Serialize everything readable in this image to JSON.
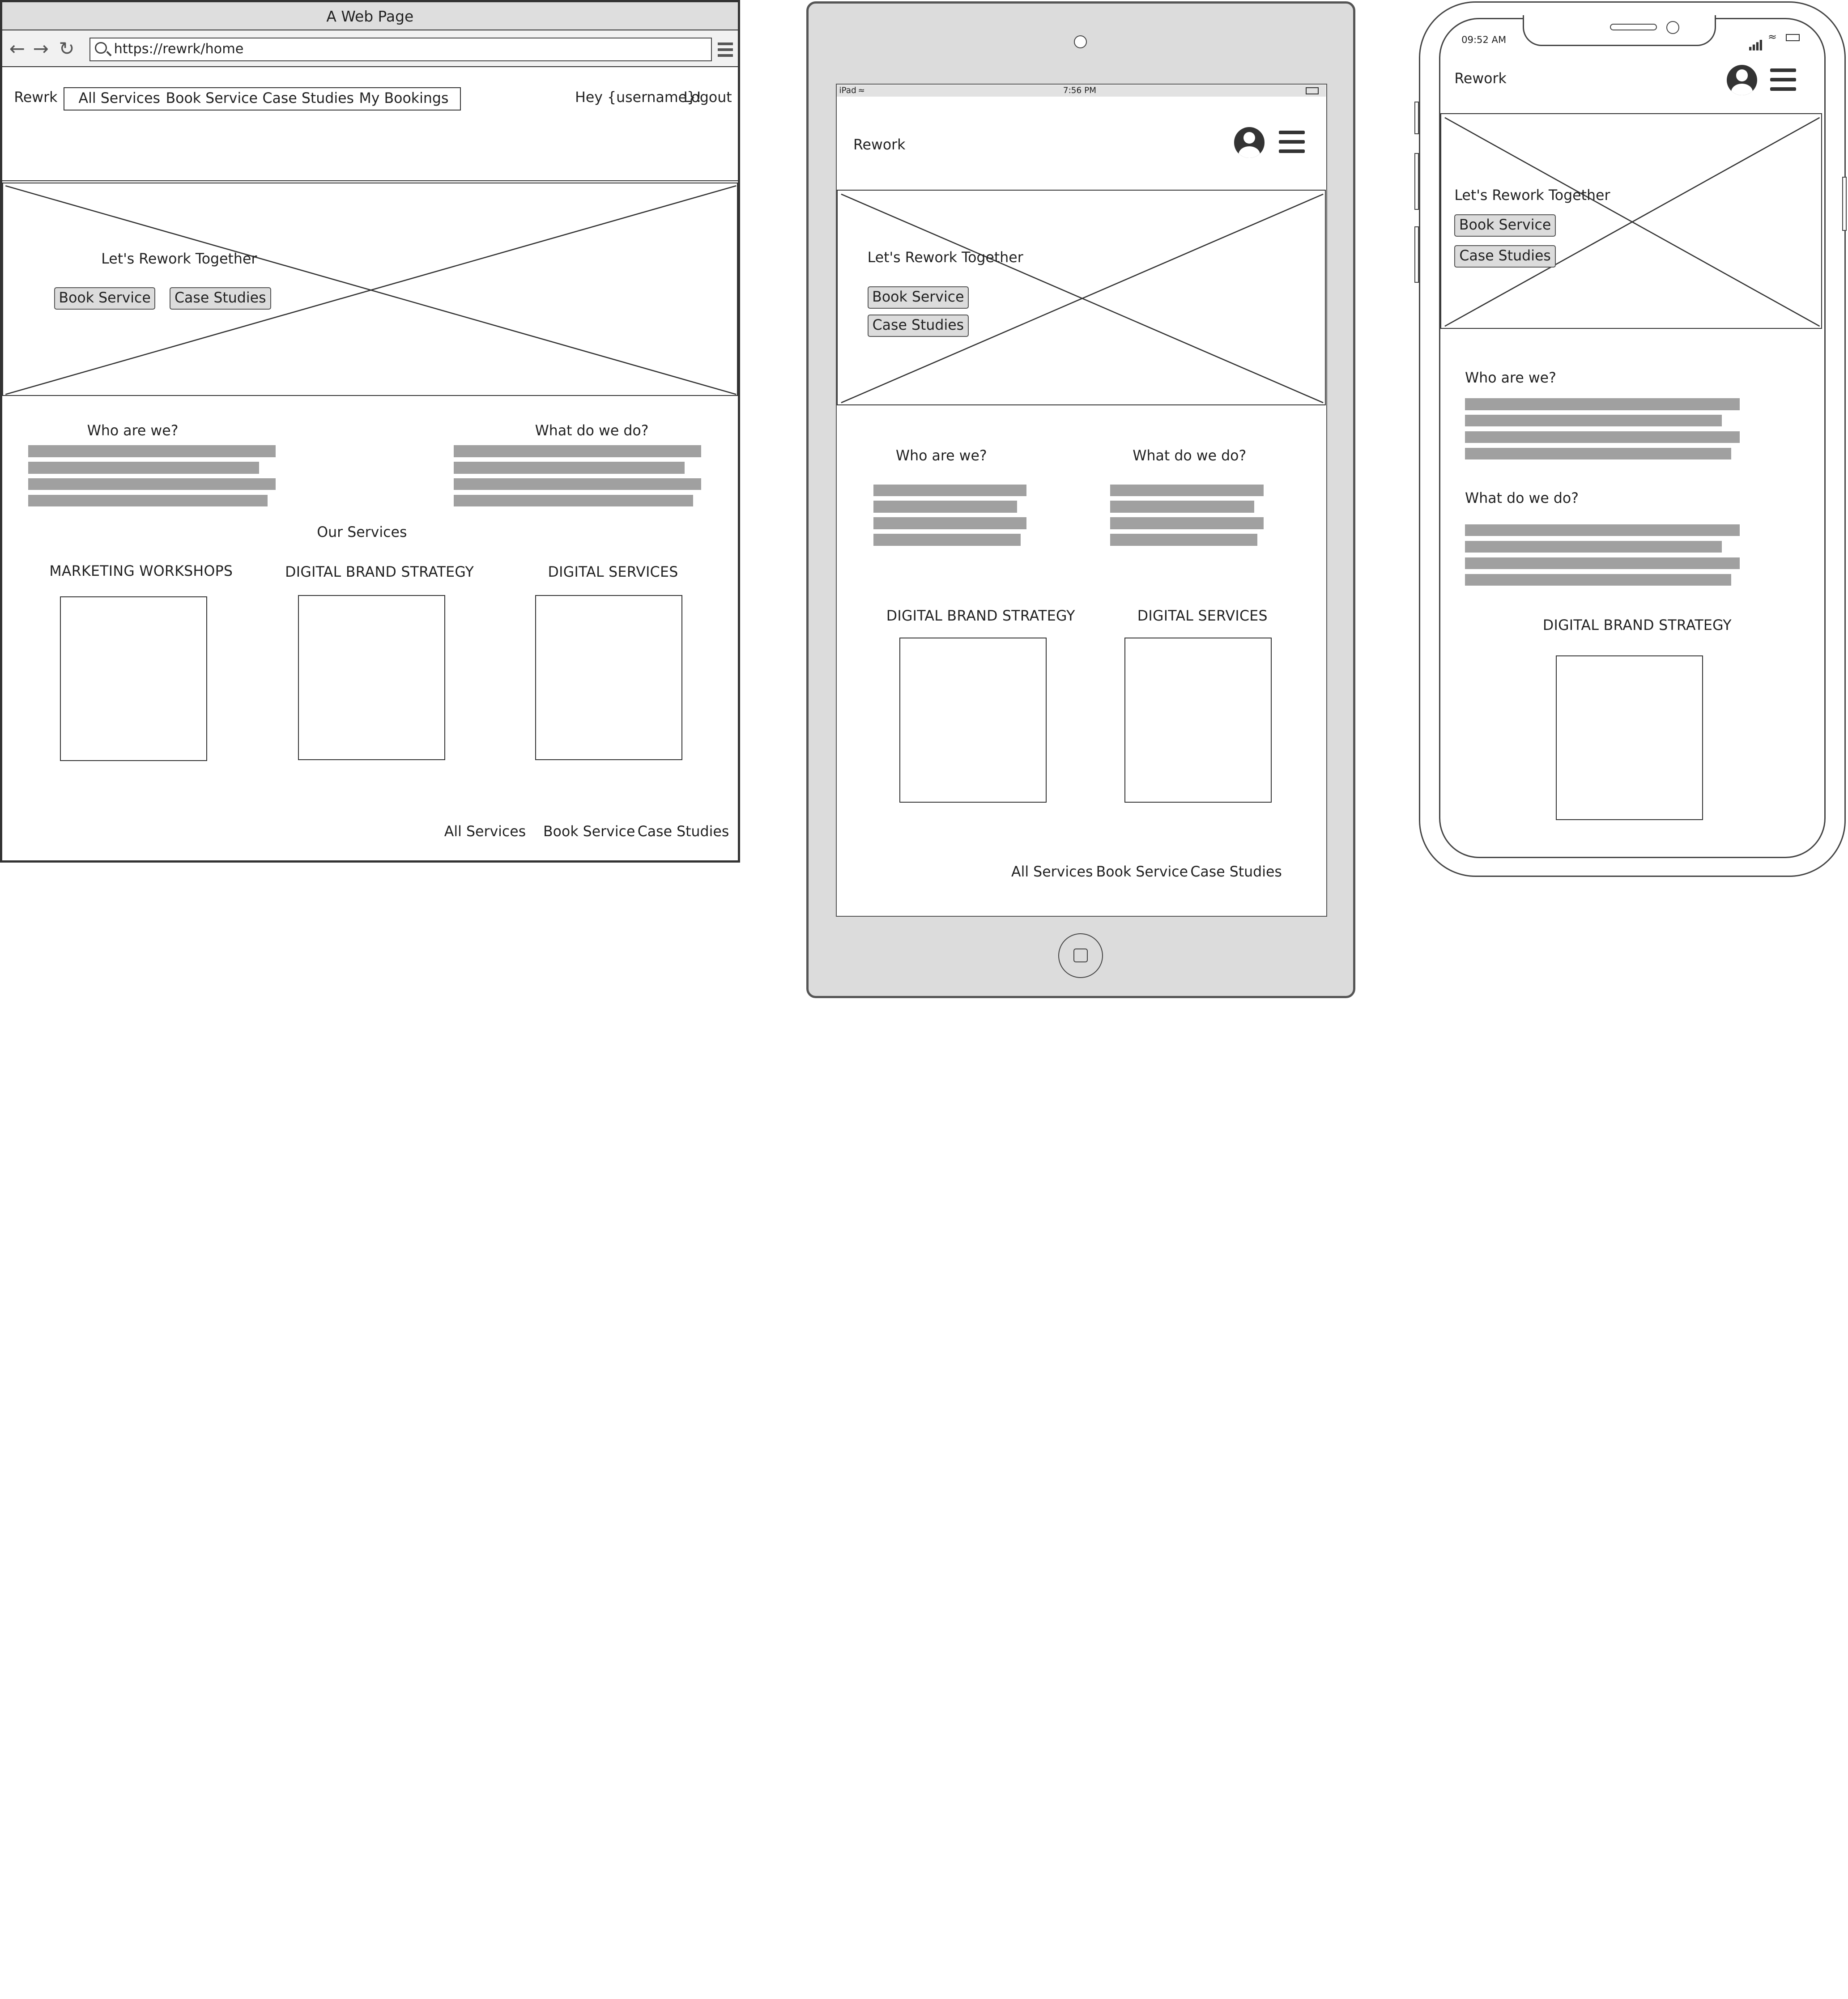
{
  "desktop": {
    "window_title": "A Web Page",
    "url": "https://rewrk/home",
    "brand": "Rewrk",
    "nav_items": [
      "All Services",
      "Book Service",
      "Case Studies",
      "My Bookings"
    ],
    "greeting": "Hey {username}!",
    "logout": "Logout",
    "hero": {
      "heading": "Let's Rework Together",
      "buttons": [
        "Book Service",
        "Case Studies"
      ]
    },
    "about": {
      "left_heading": "Who are we?",
      "right_heading": "What do we do?"
    },
    "services_heading": "Our Services",
    "services": [
      "MARKETING WORKSHOPS",
      "DIGITAL BRAND STRATEGY",
      "DIGITAL SERVICES"
    ],
    "footer_links": [
      "All Services",
      "Book Service",
      "Case Studies"
    ]
  },
  "tablet": {
    "status": {
      "device": "iPad",
      "time": "7:56 PM"
    },
    "brand": "Rework",
    "hero": {
      "heading": "Let's Rework Together",
      "buttons": [
        "Book Service",
        "Case Studies"
      ]
    },
    "about": {
      "left_heading": "Who are we?",
      "right_heading": "What do we do?"
    },
    "services": [
      "DIGITAL BRAND STRATEGY",
      "DIGITAL SERVICES"
    ],
    "footer_links": [
      "All Services",
      "Book Service",
      "Case Studies"
    ]
  },
  "mobile": {
    "status": {
      "time": "09:52 AM"
    },
    "brand": "Rework",
    "hero": {
      "heading": "Let's Rework Together",
      "buttons": [
        "Book Service",
        "Case Studies"
      ]
    },
    "about": {
      "first_heading": "Who are we?",
      "second_heading": "What do we do?"
    },
    "services": [
      "DIGITAL BRAND STRATEGY"
    ]
  },
  "icons": [
    "back-arrow-icon",
    "forward-arrow-icon",
    "reload-icon",
    "search-icon",
    "menu-icon",
    "user-icon",
    "wifi-icon",
    "battery-icon",
    "signal-icon"
  ],
  "colors": {
    "frame": "#333333",
    "device_body": "#dcdcdc",
    "placeholder_text_bar": "#a0a0a0",
    "button_fill": "#dcdcdc"
  }
}
